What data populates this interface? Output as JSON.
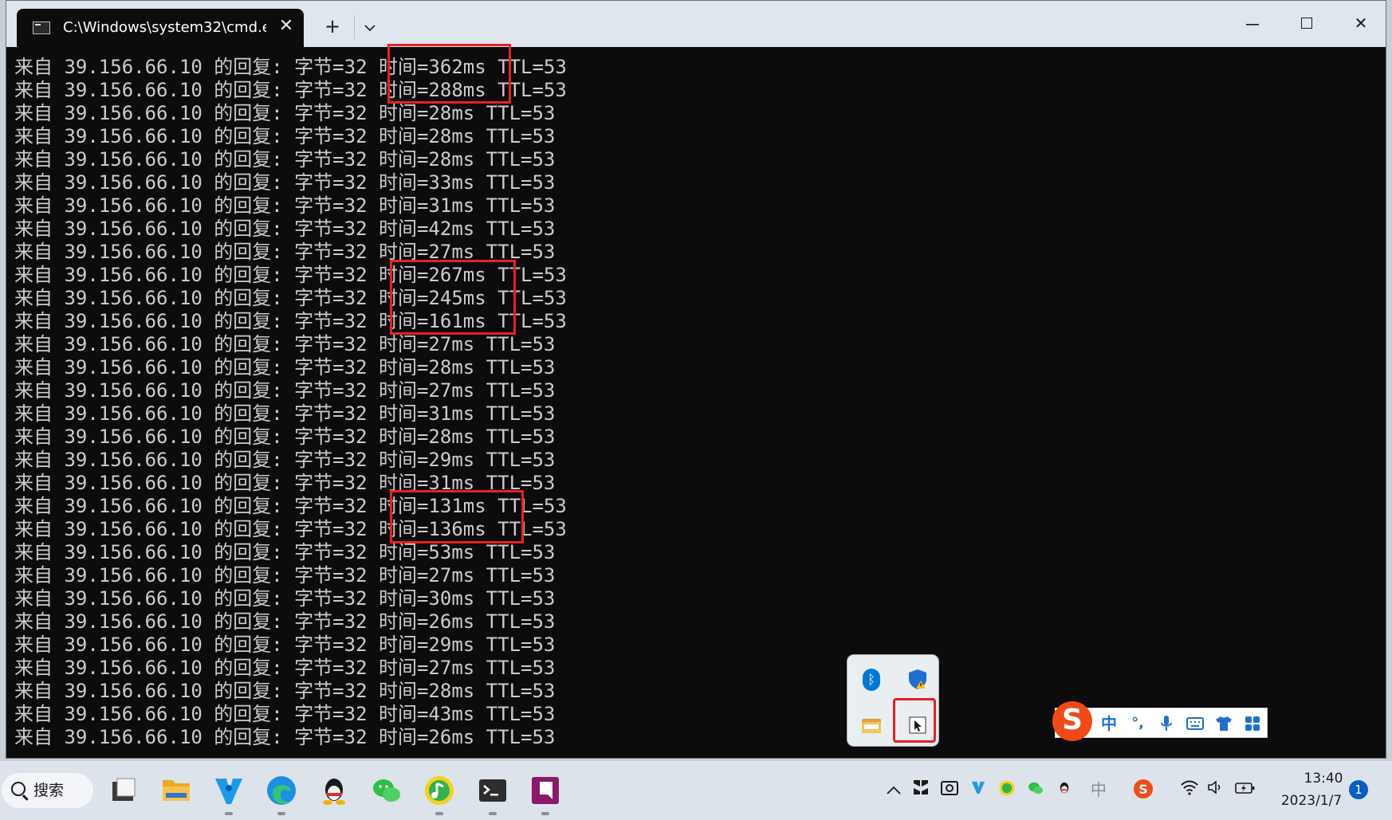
{
  "window": {
    "tab_title": "C:\\Windows\\system32\\cmd.e",
    "tab_close": "✕",
    "new_tab": "+",
    "dropdown": "⌄",
    "minimize": "—",
    "close": "✕"
  },
  "console": {
    "lines": [
      "来自 39.156.66.10 的回复: 字节=32 时间=362ms TTL=53",
      "来自 39.156.66.10 的回复: 字节=32 时间=288ms TTL=53",
      "来自 39.156.66.10 的回复: 字节=32 时间=28ms TTL=53",
      "来自 39.156.66.10 的回复: 字节=32 时间=28ms TTL=53",
      "来自 39.156.66.10 的回复: 字节=32 时间=28ms TTL=53",
      "来自 39.156.66.10 的回复: 字节=32 时间=33ms TTL=53",
      "来自 39.156.66.10 的回复: 字节=32 时间=31ms TTL=53",
      "来自 39.156.66.10 的回复: 字节=32 时间=42ms TTL=53",
      "来自 39.156.66.10 的回复: 字节=32 时间=27ms TTL=53",
      "来自 39.156.66.10 的回复: 字节=32 时间=267ms TTL=53",
      "来自 39.156.66.10 的回复: 字节=32 时间=245ms TTL=53",
      "来自 39.156.66.10 的回复: 字节=32 时间=161ms TTL=53",
      "来自 39.156.66.10 的回复: 字节=32 时间=27ms TTL=53",
      "来自 39.156.66.10 的回复: 字节=32 时间=28ms TTL=53",
      "来自 39.156.66.10 的回复: 字节=32 时间=27ms TTL=53",
      "来自 39.156.66.10 的回复: 字节=32 时间=31ms TTL=53",
      "来自 39.156.66.10 的回复: 字节=32 时间=28ms TTL=53",
      "来自 39.156.66.10 的回复: 字节=32 时间=29ms TTL=53",
      "来自 39.156.66.10 的回复: 字节=32 时间=31ms TTL=53",
      "来自 39.156.66.10 的回复: 字节=32 时间=131ms TTL=53",
      "来自 39.156.66.10 的回复: 字节=32 时间=136ms TTL=53",
      "来自 39.156.66.10 的回复: 字节=32 时间=53ms TTL=53",
      "来自 39.156.66.10 的回复: 字节=32 时间=27ms TTL=53",
      "来自 39.156.66.10 的回复: 字节=32 时间=30ms TTL=53",
      "来自 39.156.66.10 的回复: 字节=32 时间=26ms TTL=53",
      "来自 39.156.66.10 的回复: 字节=32 时间=29ms TTL=53",
      "来自 39.156.66.10 的回复: 字节=32 时间=27ms TTL=53",
      "来自 39.156.66.10 的回复: 字节=32 时间=28ms TTL=53",
      "来自 39.156.66.10 的回复: 字节=32 时间=43ms TTL=53",
      "来自 39.156.66.10 的回复: 字节=32 时间=26ms TTL=53"
    ],
    "text_color": "#cccccc",
    "background": "#0c0c0c",
    "highlight_color": "#e8211c"
  },
  "tray_popup": {
    "icons": [
      "bluetooth-icon",
      "security-shield-icon",
      "folder-icon",
      "cursor-app-icon"
    ],
    "bluetooth_glyph": "ᛒ"
  },
  "ime": {
    "logo": "S",
    "mode": "中",
    "punct": "°,",
    "items": [
      "microphone-icon",
      "keyboard-icon",
      "skin-icon",
      "toolbox-icon"
    ]
  },
  "taskbar": {
    "search_label": "搜索",
    "apps": [
      "file-explorer-icon",
      "folder-icon",
      "vpn-app-icon",
      "edge-icon",
      "qq-icon",
      "wechat-icon",
      "music-app-icon",
      "terminal-icon",
      "onenote-icon"
    ],
    "tray": {
      "chevron": "^",
      "ime_indicator": "中",
      "time": "13:40",
      "date": "2023/1/7",
      "notifications": "1"
    }
  }
}
